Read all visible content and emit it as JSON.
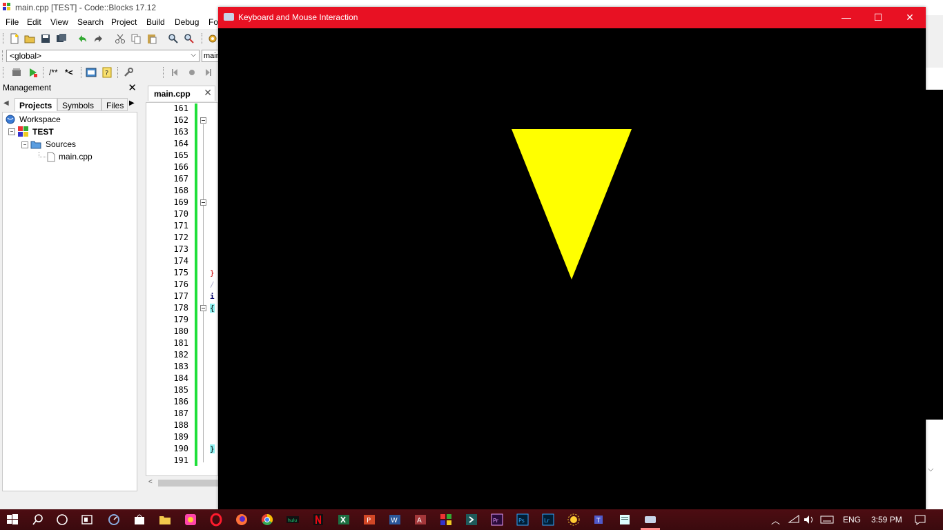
{
  "ide": {
    "window_title": "main.cpp [TEST] - Code::Blocks 17.12",
    "menu": [
      "File",
      "Edit",
      "View",
      "Search",
      "Project",
      "Build",
      "Debug",
      "Fo"
    ],
    "scope_select": "<global>",
    "function_select": "main",
    "toolbar2_text_a": "/**",
    "toolbar2_text_b": "*<",
    "management": {
      "title": "Management",
      "tabs": [
        "Projects",
        "Symbols",
        "Files"
      ],
      "tree": {
        "workspace": "Workspace",
        "project": "TEST",
        "folder": "Sources",
        "file": "main.cpp"
      }
    },
    "editor": {
      "tab_label": "main.cpp",
      "line_numbers": [
        "161",
        "162",
        "163",
        "164",
        "165",
        "166",
        "167",
        "168",
        "169",
        "170",
        "171",
        "172",
        "173",
        "174",
        "175",
        "176",
        "177",
        "178",
        "179",
        "180",
        "181",
        "182",
        "183",
        "184",
        "185",
        "186",
        "187",
        "188",
        "189",
        "190",
        "191"
      ],
      "code_fragments": {
        "line175": "}",
        "line176": "/",
        "line177": "i",
        "line178": "{",
        "line190": "}"
      }
    }
  },
  "gl_window": {
    "title": "Keyboard and Mouse Interaction",
    "minimize": "—",
    "maximize": "☐",
    "close": "✕",
    "background_color": "#000000",
    "shape_color": "#ffff00"
  },
  "taskbar": {
    "language": "ENG",
    "time": "3:59 PM",
    "accent": "#4d0d12"
  }
}
